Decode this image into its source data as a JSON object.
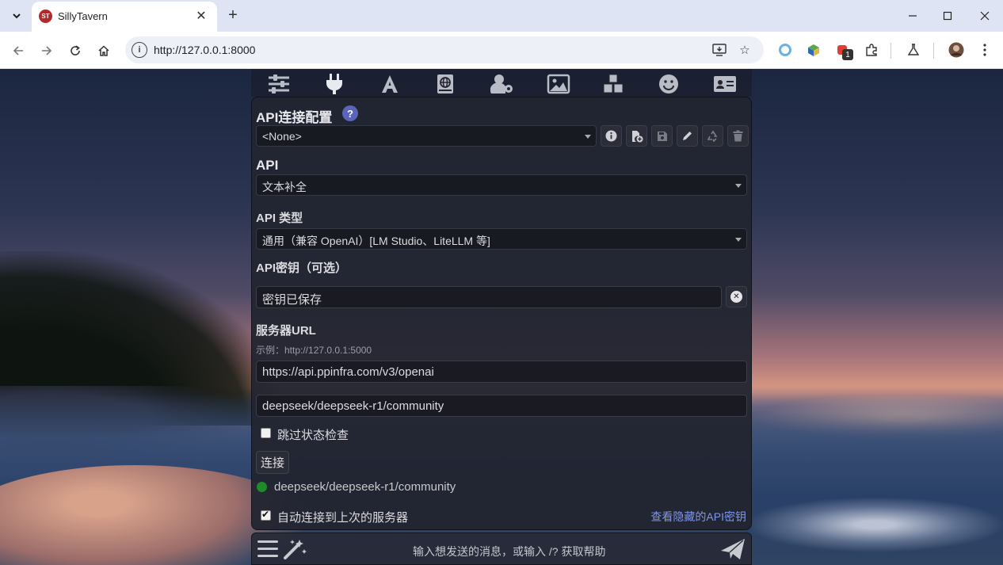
{
  "browser": {
    "tab_title": "SillyTavern",
    "favicon_text": "ST",
    "url": "http://127.0.0.1:8000",
    "extension_badge": "1"
  },
  "st_topbar": {
    "icons": [
      "sliders-icon",
      "plug-icon",
      "font-icon",
      "book-atlas-icon",
      "user-gear-icon",
      "image-icon",
      "cubes-icon",
      "smiley-icon",
      "id-card-icon"
    ],
    "active_index": 1
  },
  "api_panel": {
    "profile_heading": "API连接配置",
    "help_glyph": "?",
    "profile_value": "<None>",
    "api_heading": "API",
    "api_value": "文本补全",
    "api_type_heading": "API 类型",
    "api_type_value": "通用（兼容 OpenAI）[LM Studio、LiteLLM 等]",
    "api_key_heading": "API密钥（可选）",
    "api_key_value": "密钥已保存",
    "server_url_heading": "服务器URL",
    "server_url_hint": "示例：http://127.0.0.1:5000",
    "server_url_value": "https://api.ppinfra.com/v3/openai",
    "model_value": "deepseek/deepseek-r1/community",
    "skip_status_check_label": "跳过状态检查",
    "skip_status_check": false,
    "connect_label": "连接",
    "status_text": "deepseek/deepseek-r1/community",
    "status_color": "#1e8a2a",
    "auto_connect_label": "自动连接到上次的服务器",
    "auto_connect": true,
    "view_hidden_keys_link": "查看隐藏的API密钥"
  },
  "chat": {
    "placeholder": "输入想发送的消息，或输入 /? 获取帮助"
  },
  "colors": {
    "accent_link": "#7f95e8",
    "help_badge": "#5a64b8"
  }
}
